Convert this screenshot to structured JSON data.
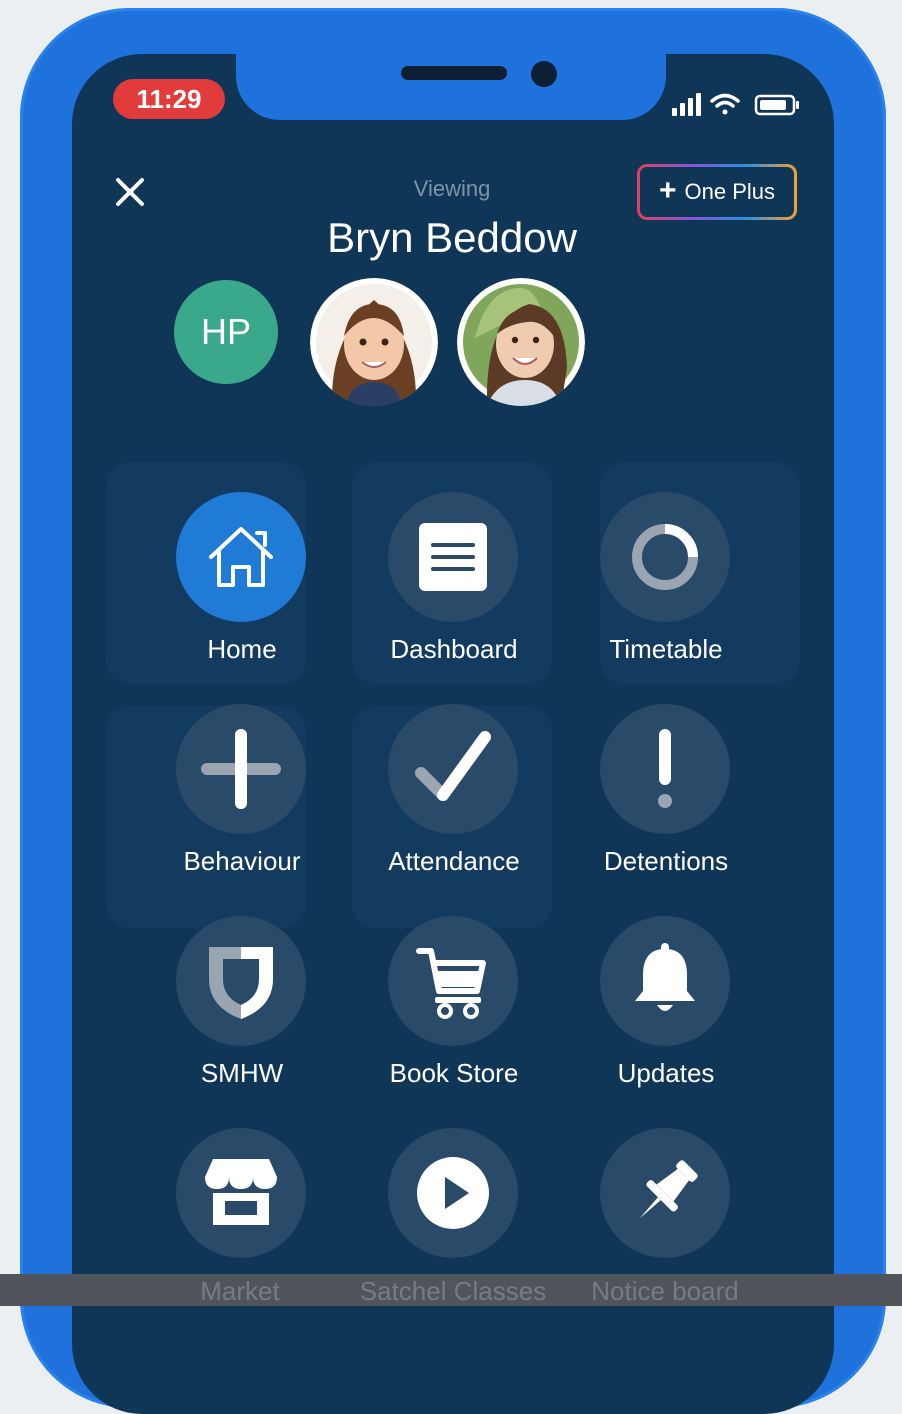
{
  "status_bar": {
    "time": "11:29"
  },
  "header": {
    "close_icon": "close-icon",
    "viewing_label": "Viewing",
    "student_name": "Bryn Beddow",
    "one_plus_label": "One Plus"
  },
  "avatars": [
    {
      "type": "initials",
      "text": "HP",
      "color": "#3aa98b"
    },
    {
      "type": "photo",
      "description_icon": "child-photo-1"
    },
    {
      "type": "photo",
      "description_icon": "child-photo-2"
    }
  ],
  "menu": [
    {
      "label": "Home",
      "icon": "home-icon",
      "active": true
    },
    {
      "label": "Dashboard",
      "icon": "dashboard-icon",
      "active": false
    },
    {
      "label": "Timetable",
      "icon": "timetable-icon",
      "active": false
    },
    {
      "label": "Behaviour",
      "icon": "plus-icon",
      "active": false
    },
    {
      "label": "Attendance",
      "icon": "checkmark-icon",
      "active": false
    },
    {
      "label": "Detentions",
      "icon": "exclamation-icon",
      "active": false
    },
    {
      "label": "SMHW",
      "icon": "shield-icon",
      "active": false
    },
    {
      "label": "Book Store",
      "icon": "cart-icon",
      "active": false
    },
    {
      "label": "Updates",
      "icon": "bell-icon",
      "active": false
    },
    {
      "label": "Market",
      "icon": "store-icon",
      "active": false
    },
    {
      "label": "Satchel Classes",
      "icon": "play-icon",
      "active": false
    },
    {
      "label": "Notice board",
      "icon": "pin-icon",
      "active": false
    }
  ],
  "colors": {
    "phone_frame": "#1f72dc",
    "screen_bg": "#0f3557",
    "active_circle": "#1f7bd6",
    "icon_circle": "#294a68",
    "time_pill": "#e23b3b"
  }
}
